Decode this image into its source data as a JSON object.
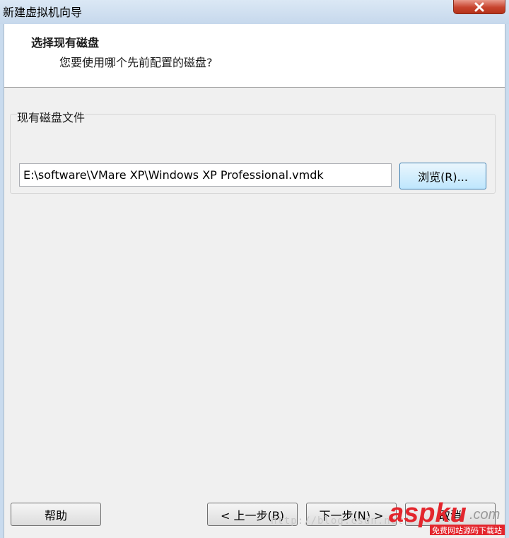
{
  "window": {
    "title": "新建虚拟机向导"
  },
  "header": {
    "title": "选择现有磁盘",
    "subtitle": "您要使用哪个先前配置的磁盘?"
  },
  "group": {
    "label": "现有磁盘文件"
  },
  "disk": {
    "path": "E:\\software\\VMare XP\\Windows XP Professional.vmdk"
  },
  "buttons": {
    "browse": "浏览(R)...",
    "help": "帮助",
    "back": "< 上一步(B)",
    "next": "下一步(N) >",
    "cancel": "取消"
  },
  "watermark": {
    "text": "http://blog.csdn.net"
  },
  "logo": {
    "brand": "aspku",
    "suffix": ".com",
    "tagline": "免费网站源码下载站"
  },
  "colors": {
    "logo_red": "#e3262d",
    "close": "#c7442e"
  }
}
